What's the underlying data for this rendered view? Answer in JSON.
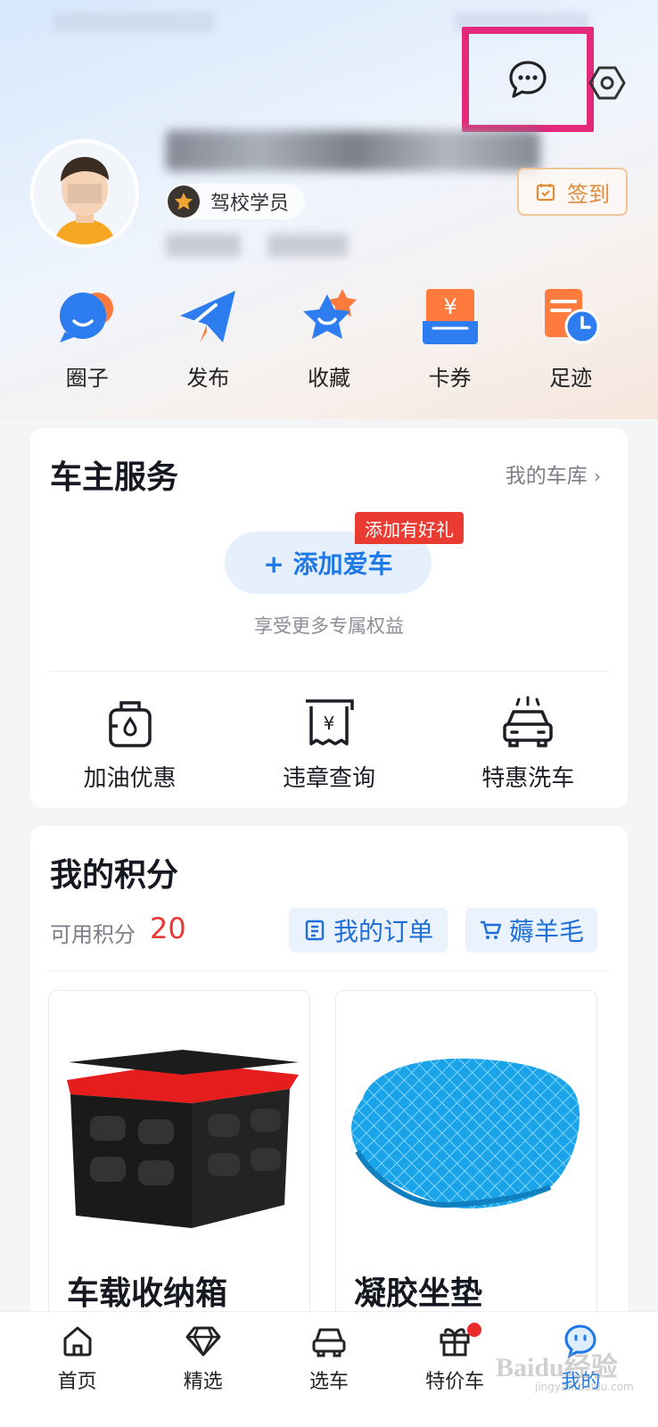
{
  "header": {
    "user_badge": "驾校学员",
    "signin_label": "签到"
  },
  "quick_actions": [
    {
      "label": "圈子",
      "icon": "chat-bubbles-icon"
    },
    {
      "label": "发布",
      "icon": "paper-plane-icon"
    },
    {
      "label": "收藏",
      "icon": "star-icon"
    },
    {
      "label": "卡券",
      "icon": "coupon-icon"
    },
    {
      "label": "足迹",
      "icon": "history-icon"
    }
  ],
  "owner_service": {
    "title": "车主服务",
    "garage_link": "我的车库",
    "add_car_label": "+ 添加爱车",
    "gift_tag": "添加有好礼",
    "add_car_subtitle": "享受更多专属权益",
    "services": [
      {
        "label": "加油优惠",
        "icon": "fuel-icon"
      },
      {
        "label": "违章查询",
        "icon": "violation-receipt-icon"
      },
      {
        "label": "特惠洗车",
        "icon": "car-wash-icon"
      }
    ]
  },
  "points": {
    "title": "我的积分",
    "available_label": "可用积分",
    "available_value": "20",
    "orders_label": "我的订单",
    "deals_label": "薅羊毛",
    "products": [
      {
        "name": "车载收纳箱"
      },
      {
        "name": "凝胶坐垫"
      }
    ]
  },
  "tabbar": {
    "items": [
      {
        "label": "首页",
        "icon": "home-icon"
      },
      {
        "label": "精选",
        "icon": "diamond-icon"
      },
      {
        "label": "选车",
        "icon": "car-icon"
      },
      {
        "label": "特价车",
        "icon": "gift-icon"
      },
      {
        "label": "我的",
        "icon": "profile-bubble-icon"
      }
    ],
    "active_index": 4
  },
  "watermark": {
    "text": "Baidu经验",
    "sub": "jingyan.baidu.com"
  },
  "colors": {
    "accent": "#1e78e6",
    "highlight_box": "#e2297a",
    "points_red": "#e53935",
    "signin_orange": "#e08c3b"
  }
}
